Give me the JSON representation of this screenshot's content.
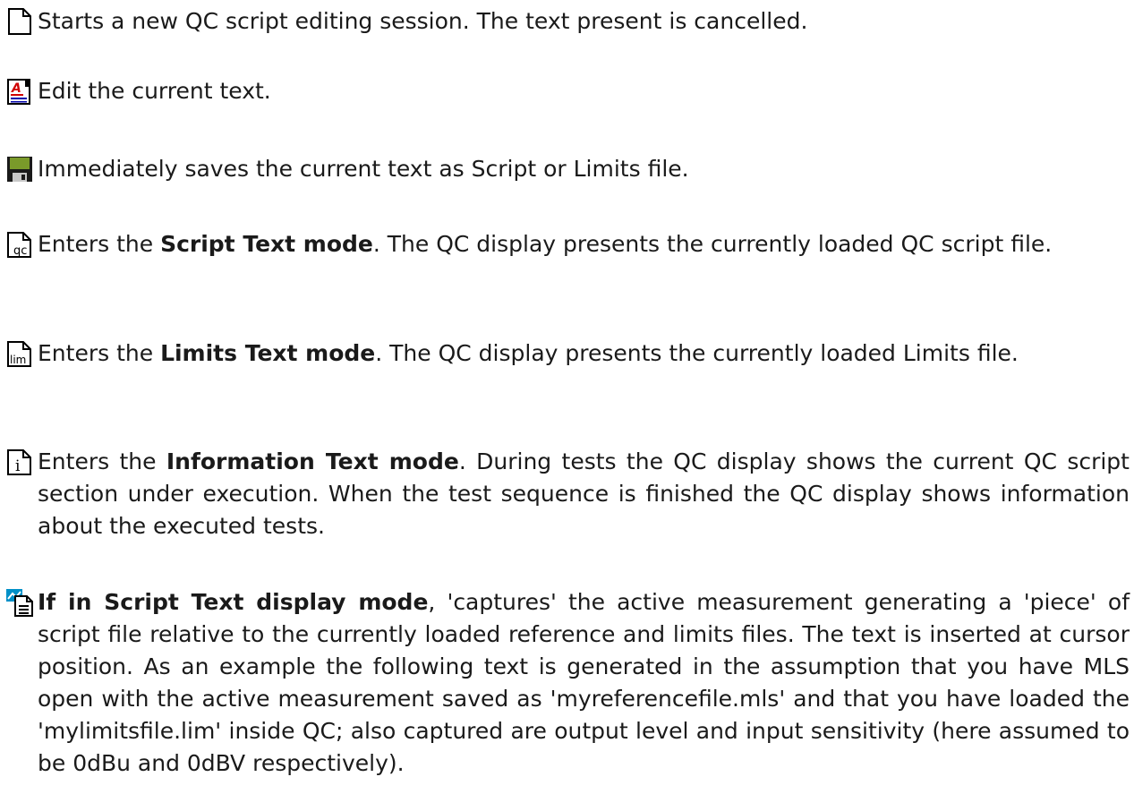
{
  "items": [
    {
      "icon": "new-document-icon",
      "text": "Starts a new QC script editing session. The text present is cancelled."
    },
    {
      "icon": "edit-text-icon",
      "text": "Edit the current text."
    },
    {
      "icon": "save-disk-icon",
      "text": "Immediately saves the current text as Script or Limits file."
    },
    {
      "icon": "script-text-mode-icon",
      "pre": "Enters the ",
      "bold": "Script Text mode",
      "post": ". The QC display presents the currently loaded QC script file."
    },
    {
      "icon": "limits-text-mode-icon",
      "pre": "Enters the ",
      "bold": "Limits Text mode",
      "post": ". The QC display presents the currently loaded Limits file."
    },
    {
      "icon": "information-text-mode-icon",
      "pre": "Enters the ",
      "bold": "Information Text mode",
      "post": ". During tests the QC display shows the current QC script section under execution. When the test sequence is finished the QC display shows information about the executed tests."
    },
    {
      "icon": "capture-measurement-icon",
      "bold": "If in Script Text display mode",
      "post": ", 'captures' the active measurement generating a 'piece' of script file relative to the currently loaded reference and limits files. The text is inserted at cursor position. As an example the following text is generated  in the assumption that you have MLS open with the active measurement saved as 'myreferencefile.mls' and that you have loaded the 'mylimitsfile.lim' inside QC; also captured are output level and input sensitivity (here assumed to be 0dBu and 0dBV respectively)."
    }
  ]
}
